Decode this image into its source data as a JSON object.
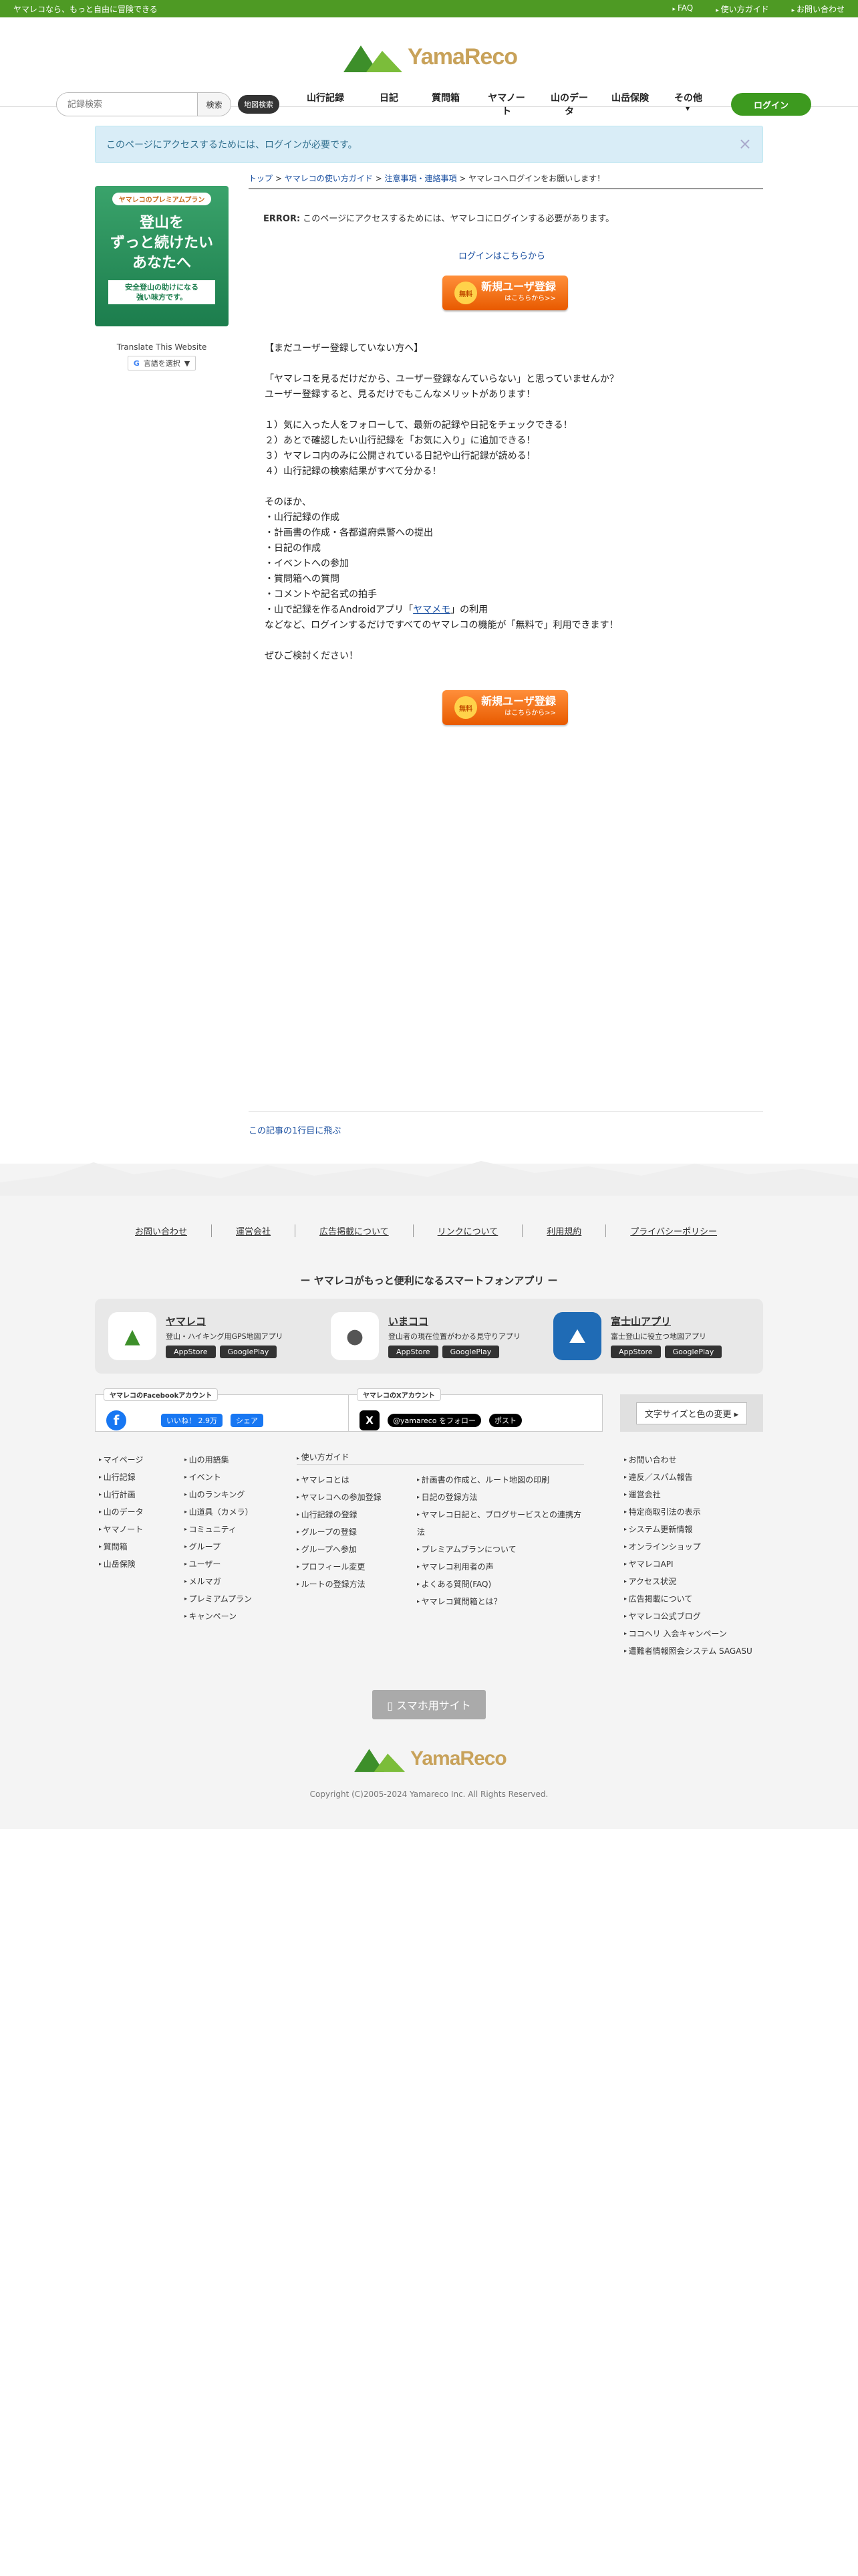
{
  "topbar": {
    "tagline": "ヤマレコなら、もっと自由に冒険できる",
    "links": [
      "FAQ",
      "使い方ガイド",
      "お問い合わせ"
    ]
  },
  "header": {
    "logo_text": "YamaReco",
    "search_placeholder": "記録検索",
    "search_button": "検索",
    "map_search": "地図検索",
    "nav": [
      "山行記録",
      "日記",
      "質問箱",
      "ヤマノート",
      "山のデータ",
      "山岳保険",
      "その他"
    ],
    "login_button": "ログイン"
  },
  "alert": {
    "text": "このページにアクセスするためには、ログインが必要です。",
    "close": "×"
  },
  "sidebar": {
    "promo_tag": "ヤマレコのプレミアムプラン",
    "promo_line1": "登山を",
    "promo_line2": "ずっと続けたい",
    "promo_line3": "あなたへ",
    "promo_sub1": "安全登山の助けになる",
    "promo_sub2": "強い味方です。",
    "translate_label": "Translate This Website",
    "lang_select": "言語を選択"
  },
  "breadcrumb": {
    "top": "トップ",
    "guide": "ヤマレコの使い方ガイド",
    "notice": "注意事項・連絡事項",
    "current": "ヤマレコへログインをお願いします！"
  },
  "error": {
    "label": "ERROR:",
    "text": " このページにアクセスするためには、ヤマレコにログインする必要があります。"
  },
  "login_link": "ログインはこちらから",
  "register_button": {
    "badge": "無料",
    "label": "新規ユーザ登録",
    "sub": "はこちらから>>"
  },
  "body": {
    "intro": "【まだユーザー登録していない方へ】\n\n「ヤマレコを見るだけだから、ユーザー登録なんていらない」と思っていませんか？\nユーザー登録すると、見るだけでもこんなメリットがあります！\n\n１）気に入った人をフォローして、最新の記録や日記をチェックできる！\n２）あとで確認したい山行記録を「お気に入り」に追加できる！\n３）ヤマレコ内のみに公開されている日記や山行記録が読める！\n４）山行記録の検索結果がすべて分かる！\n\nそのほか、\n・山行記録の作成\n・計画書の作成・各都道府県警への提出\n・日記の作成\n・イベントへの参加\n・質問箱への質問\n・コメントや記名式の拍手\n・山で記録を作るAndroidアプリ「",
    "app_link": "ヤマメモ",
    "outro": "」の利用\nなどなど、ログインするだけですべてのヤマレコの機能が「無料で」利用できます！\n\nぜひご検討ください！"
  },
  "top_link": "この記事の1行目に飛ぶ",
  "footer": {
    "links": [
      "お問い合わせ",
      "運営会社",
      "広告掲載について",
      "リンクについて",
      "利用規約",
      "プライバシーポリシー"
    ],
    "app_title": "ー ヤマレコがもっと便利になるスマートフォンアプリ ー",
    "apps": [
      {
        "name": "ヤマレコ",
        "desc": "登山・ハイキング用GPS地図アプリ",
        "icon": "▲"
      },
      {
        "name": "いまココ",
        "desc": "登山者の現在位置がわかる見守りアプリ",
        "icon": "●"
      },
      {
        "name": "富士山アプリ",
        "desc": "富士登山に役立つ地図アプリ",
        "icon": "⛰"
      }
    ],
    "store_app": "AppStore",
    "store_play": "GooglePlay",
    "fb_caption": "ヤマレコのFacebookアカウント",
    "fb_like": "いいね！ 2.9万",
    "fb_share": "シェア",
    "x_caption": "ヤマレコのXアカウント",
    "x_follow": "@yamareco をフォロー",
    "x_post": "ポスト",
    "font_button": "文字サイズと色の変更 ▸",
    "col1": [
      "マイページ",
      "山行記録",
      "山行計画",
      "山のデータ",
      "ヤマノート",
      "質問箱",
      "山岳保険"
    ],
    "col2": [
      "山の用語集",
      "イベント",
      "山のランキング",
      "山道具（カメラ）",
      "コミュニティ",
      "グループ",
      "ユーザー",
      "メルマガ",
      "プレミアムプラン",
      "キャンペーン"
    ],
    "guide_head": "使い方ガイド",
    "col3": [
      "ヤマレコとは",
      "ヤマレコへの参加登録",
      "山行記録の登録",
      "グループの登録",
      "グループへ参加",
      "プロフィール変更",
      "ルートの登録方法"
    ],
    "col4": [
      "計画書の作成と、ルート地図の印刷",
      "日記の登録方法",
      "ヤマレコ日記と、ブログサービスとの連携方法",
      "プレミアムプランについて",
      "ヤマレコ利用者の声",
      "よくある質問(FAQ)",
      "ヤマレコ質問箱とは？"
    ],
    "col5": [
      "お問い合わせ",
      "違反／スパム報告",
      "運営会社",
      "特定商取引法の表示",
      "システム更新情報",
      "オンラインショップ",
      "ヤマレコAPI",
      "アクセス状況",
      "広告掲載について",
      "ヤマレコ公式ブログ",
      "ココヘリ 入会キャンペーン",
      "遭難者情報照会システム SAGASU"
    ],
    "smartphone_button": "▯ スマホ用サイト",
    "copyright": "Copyright (C)2005-2024 Yamareco Inc. All Rights Reserved."
  },
  "colors": {
    "brand_green": "#4e9a24",
    "logo_gold": "#c8a25a",
    "register_orange": "#e85a00"
  }
}
